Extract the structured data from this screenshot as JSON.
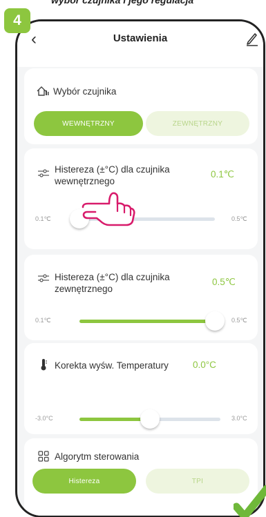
{
  "caption": "wybór czujnika i jego regulacja",
  "step_badge": "4",
  "header": {
    "back_icon": "chevron-left-icon",
    "title": "Ustawienia",
    "edit_icon": "pencil-icon"
  },
  "sensor_select": {
    "icon": "home-sensor-icon",
    "label": "Wybór czujnika",
    "options": [
      "WEWNĘTRZNY",
      "ZEWNĘTRZNY"
    ],
    "selected": "WEWNĘTRZNY"
  },
  "hysteresis_internal": {
    "icon": "sliders-icon",
    "label_line1": "Histereza (±°C) dla czujnika",
    "label_line2": "wewnętrznego",
    "value": "0.1℃",
    "min_label": "0.1℃",
    "max_label": "0.5℃",
    "level": 0.0
  },
  "hysteresis_external": {
    "icon": "sliders-icon",
    "label_line1": "Histereza (±°C) dla czujnika",
    "label_line2": "zewnętrznego",
    "value": "0.5℃",
    "min_label": "0.1℃",
    "max_label": "0.5℃",
    "level": 1.0
  },
  "temp_correction": {
    "icon": "thermometer-icon",
    "label": "Korekta wyśw. Temperatury",
    "value": "0.0°C",
    "min_label": "-3.0°C",
    "max_label": "3.0°C",
    "level": 0.5
  },
  "algorithm": {
    "icon": "grid-icon",
    "label": "Algorytm sterowania",
    "options": [
      "Histereza",
      "TPI"
    ],
    "selected": "Histereza"
  },
  "overlays": {
    "pointer": "pointing-hand-icon",
    "confirm": "green-check-icon"
  },
  "colors": {
    "accent": "#8dc63f",
    "accent_light": "#eef5df",
    "track": "#dde3ea",
    "background": "#f4f5f6"
  }
}
